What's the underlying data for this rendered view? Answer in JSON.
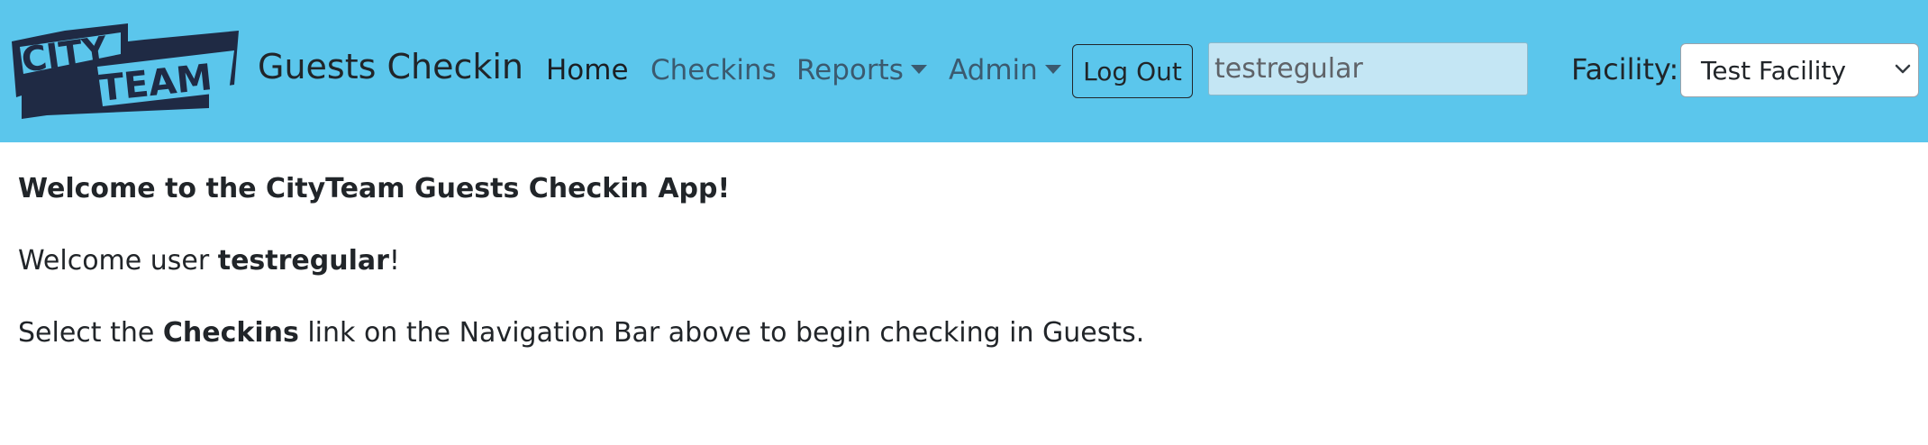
{
  "brand": {
    "logo_text_top": "CITY",
    "logo_text_bottom": "TEAM",
    "title": "Guests Checkin"
  },
  "nav": {
    "home": "Home",
    "checkins": "Checkins",
    "reports": "Reports",
    "admin": "Admin",
    "logout": "Log Out"
  },
  "user": {
    "value": "testregular"
  },
  "facility": {
    "label": "Facility:",
    "selected": "Test Facility"
  },
  "content": {
    "heading": "Welcome to the CityTeam Guests Checkin App!",
    "welcome_prefix": "Welcome user ",
    "welcome_user": "testregular",
    "welcome_suffix": "!",
    "select_prefix": "Select the ",
    "select_link": "Checkins",
    "select_suffix": " link on the Navigation Bar above to begin checking in Guests."
  },
  "colors": {
    "navbar_bg": "#5bc6ec",
    "logo_dark": "#1f2a44",
    "nav_link": "#3b5a6f",
    "input_bg": "#c4e6f4"
  }
}
